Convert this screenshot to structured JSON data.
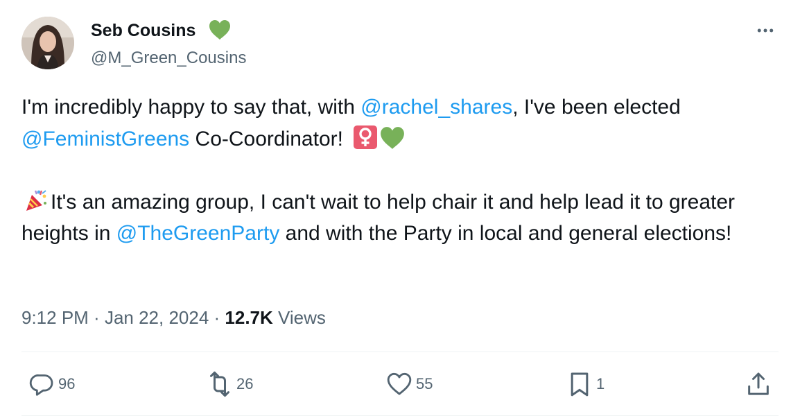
{
  "author": {
    "display_name": "Seb Cousins",
    "handle": "@M_Green_Cousins",
    "name_emoji": "green-heart-icon"
  },
  "tweet": {
    "paragraph1": {
      "text1": "I'm incredibly happy to say that, with ",
      "mention1": "@rachel_shares",
      "text2": ", I've been elected ",
      "mention2": "@FeministGreens",
      "text3": " Co-Coordinator! "
    },
    "paragraph2": {
      "text1": "It's an amazing group, I can't wait to help chair it and help lead it to greater heights in ",
      "mention1": "@TheGreenParty",
      "text2": " and with the Party in local and general elections!"
    }
  },
  "meta": {
    "time": "9:12 PM",
    "separator1": " · ",
    "date": "Jan 22, 2024",
    "separator2": " · ",
    "views_count": "12.7K",
    "views_label": " Views"
  },
  "actions": {
    "replies": "96",
    "reposts": "26",
    "likes": "55",
    "bookmarks": "1"
  },
  "colors": {
    "mention": "#1d9bf0",
    "secondary_text": "#536471",
    "primary_text": "#0f1419",
    "green_heart": "#78b159",
    "female_sign_bg": "#ea596e"
  }
}
